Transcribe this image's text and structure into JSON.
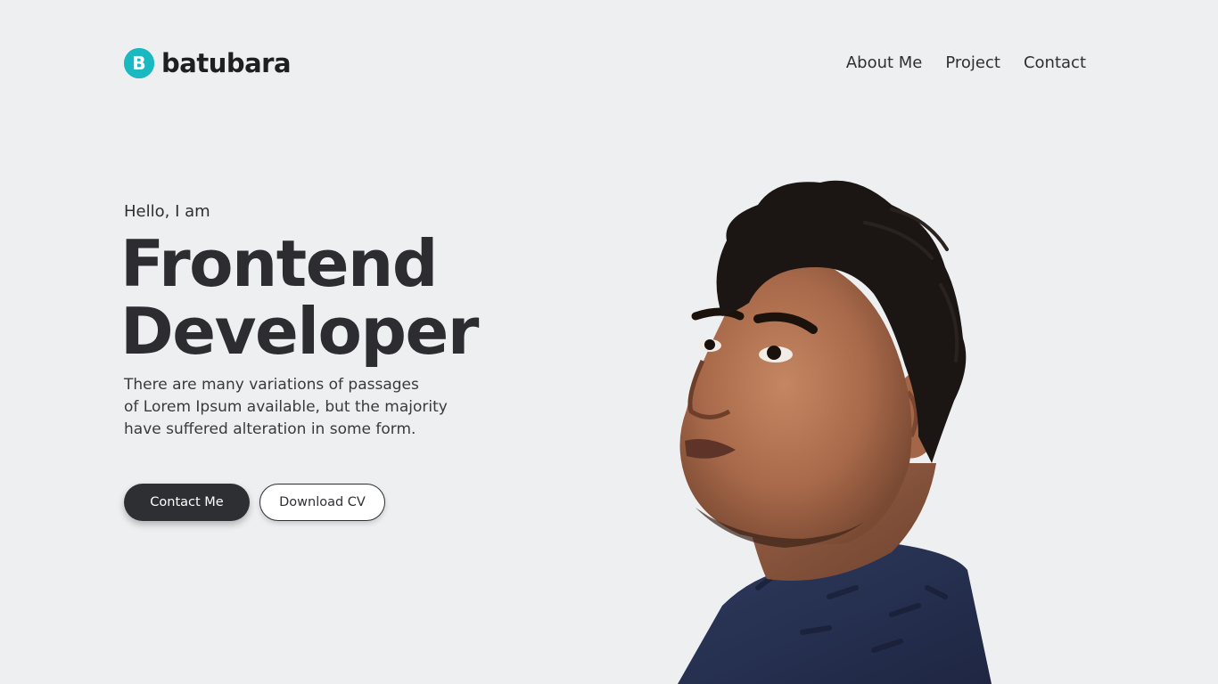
{
  "header": {
    "logo_letter": "B",
    "logo_text": "batubara",
    "nav": [
      {
        "label": "About Me"
      },
      {
        "label": "Project"
      },
      {
        "label": "Contact"
      }
    ]
  },
  "hero": {
    "greeting": "Hello, I am",
    "title_line1": "Frontend",
    "title_line2": "Developer",
    "description_lines": [
      "There are many variations of passages",
      "of Lorem Ipsum available, but the majority",
      "have suffered alteration in some form."
    ],
    "primary_button": "Contact Me",
    "secondary_button": "Download CV"
  },
  "colors": {
    "background": "#eeeff1",
    "logo_accent": "#1ab8c0",
    "dark": "#2e2f33",
    "shirt": "#26304f"
  },
  "icons": {
    "logo": "b-circle-logo-icon"
  }
}
